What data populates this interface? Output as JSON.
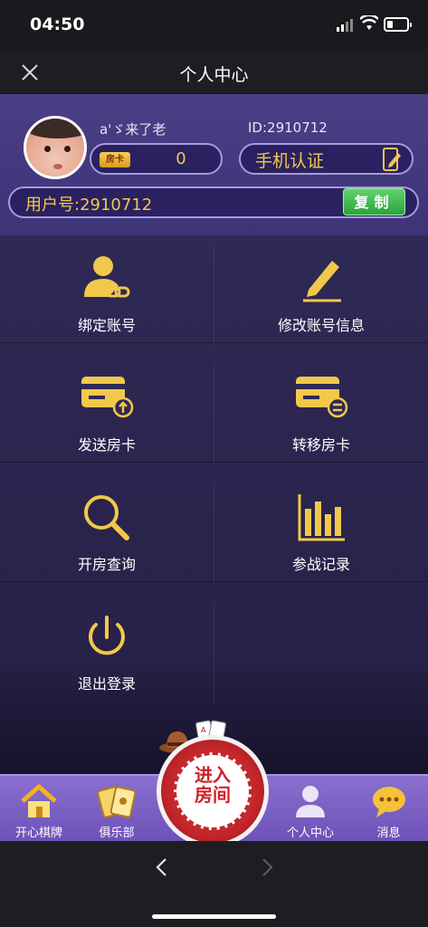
{
  "status_bar": {
    "time": "04:50"
  },
  "nav": {
    "title": "个人中心"
  },
  "profile": {
    "nickname": "a'ゞ来了老",
    "id_label": "ID:2910712",
    "room_card_tag": "房卡",
    "room_card_count": "0",
    "phone_verify_label": "手机认证",
    "user_number": "用户号:2910712",
    "copy_label": "复制"
  },
  "menu": {
    "items": [
      {
        "label": "绑定账号",
        "icon": "user-link-icon"
      },
      {
        "label": "修改账号信息",
        "icon": "pencil-edit-icon"
      },
      {
        "label": "发送房卡",
        "icon": "card-send-icon"
      },
      {
        "label": "转移房卡",
        "icon": "card-transfer-icon"
      },
      {
        "label": "开房查询",
        "icon": "search-icon"
      },
      {
        "label": "参战记录",
        "icon": "bar-chart-icon"
      },
      {
        "label": "退出登录",
        "icon": "power-icon"
      }
    ]
  },
  "tabbar": {
    "items": [
      {
        "label": "开心棋牌",
        "icon": "home-icon"
      },
      {
        "label": "俱乐部",
        "icon": "cards-club-icon"
      },
      {
        "label": "进入房间",
        "icon": "poker-chip-icon"
      },
      {
        "label": "个人中心",
        "icon": "person-icon"
      },
      {
        "label": "消息",
        "icon": "chat-bubble-icon"
      }
    ]
  },
  "colors": {
    "accent_gold": "#f2c84b",
    "header_purple": "#4b3f86",
    "grid_bg": "#2f2956",
    "tab_purple": "#7b5fc4",
    "copy_green": "#3cb548",
    "chip_red": "#c3262b"
  }
}
